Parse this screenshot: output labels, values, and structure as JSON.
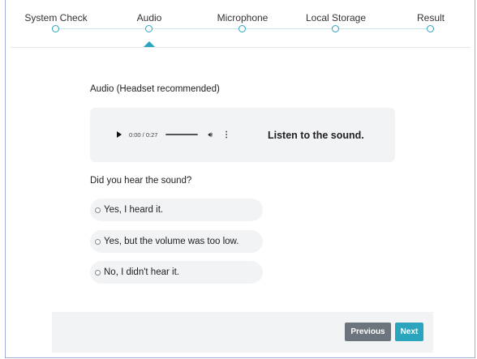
{
  "stepper": {
    "steps": [
      {
        "label": "System Check"
      },
      {
        "label": "Audio"
      },
      {
        "label": "Microphone"
      },
      {
        "label": "Local Storage"
      },
      {
        "label": "Result"
      }
    ],
    "active_index": 1
  },
  "audio_section": {
    "title": "Audio (Headset recommended)",
    "player": {
      "time": "0:00 / 0:27",
      "progress": 0.0
    },
    "listen_text": "Listen to the sound."
  },
  "question": {
    "text": "Did you hear the sound?",
    "options": [
      {
        "label": "Yes, I heard it."
      },
      {
        "label": "Yes, but the volume was too low."
      },
      {
        "label": "No, I didn't hear it."
      }
    ]
  },
  "footer": {
    "previous_label": "Previous",
    "next_label": "Next"
  },
  "colors": {
    "accent": "#2aa5bd",
    "secondary_button": "#6c757d",
    "panel_bg": "#f2f3f5"
  },
  "icons": {
    "play": "play-icon",
    "volume": "volume-icon",
    "menu": "more-vertical-icon"
  }
}
